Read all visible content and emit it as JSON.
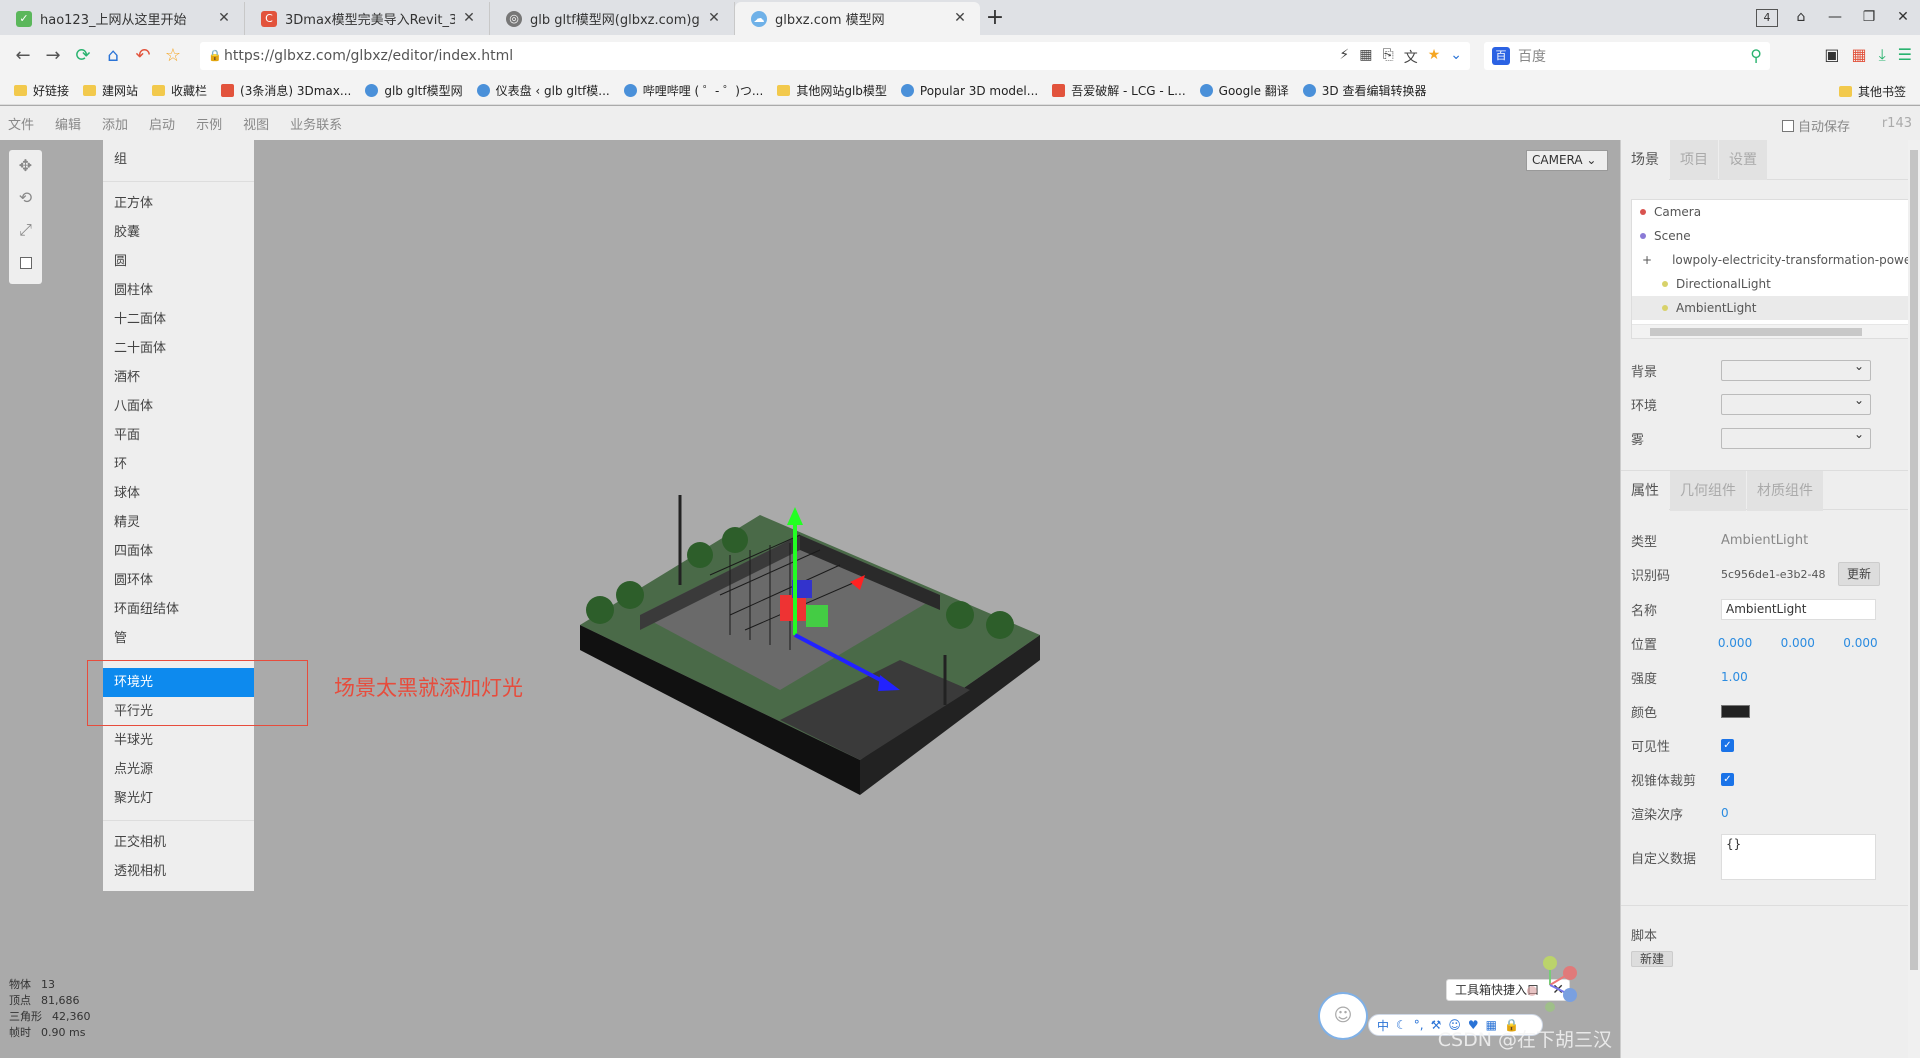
{
  "browser": {
    "tabs": [
      {
        "title": "hao123_上网从这里开始",
        "active": false
      },
      {
        "title": "3Dmax模型完美导入Revit_3dmax",
        "active": false
      },
      {
        "title": "glb gltf模型网(glbxz.com)glb模",
        "active": false
      },
      {
        "title": "glbxz.com 模型网",
        "active": true
      }
    ],
    "tab_count": "4",
    "url": "https://glbxz.com/glbxz/editor/index.html",
    "search_placeholder": "百度",
    "bookmarks": [
      "好链接",
      "建网站",
      "收藏栏",
      "(3条消息) 3Dmax...",
      "glb gltf模型网",
      "仪表盘 ‹ glb gltf模...",
      "哔哩哔哩 ( ゜- ゜)つ...",
      "其他网站glb模型",
      "Popular 3D model...",
      "吾爱破解 - LCG - L...",
      "Google 翻译",
      "3D 查看编辑转换器"
    ],
    "other_bookmarks": "其他书签"
  },
  "editor": {
    "menu": [
      "文件",
      "编辑",
      "添加",
      "启动",
      "示例",
      "视图",
      "业务联系"
    ],
    "autosave_label": "自动保存",
    "version": "r143",
    "camera_label": "CAMERA",
    "add_menu": {
      "group": "组",
      "meshes": [
        "正方体",
        "胶囊",
        "圆",
        "圆柱体",
        "十二面体",
        "二十面体",
        "酒杯",
        "八面体",
        "平面",
        "环",
        "球体",
        "精灵",
        "四面体",
        "圆环体",
        "环面纽结体",
        "管"
      ],
      "lights": [
        "环境光",
        "平行光",
        "半球光",
        "点光源",
        "聚光灯"
      ],
      "selected_light": "环境光",
      "cameras": [
        "正交相机",
        "透视相机"
      ]
    },
    "annotation": "场景太黑就添加灯光",
    "stats": [
      {
        "label": "物体",
        "value": "13"
      },
      {
        "label": "顶点",
        "value": "81,686"
      },
      {
        "label": "三角形",
        "value": "42,360"
      },
      {
        "label": "帧时",
        "value": "0.90 ms"
      }
    ],
    "toolbox_tip": "工具箱快捷入口",
    "ime_first": "中",
    "watermark": "CSDN @在下胡三汉"
  },
  "sidebar": {
    "tabs": [
      "场景",
      "项目",
      "设置"
    ],
    "outliner": [
      {
        "name": "Camera",
        "dot": "#d9534f",
        "indent": 0
      },
      {
        "name": "Scene",
        "dot": "#8a7ad6",
        "indent": 0
      },
      {
        "name": "lowpoly-electricity-transformation-power-plant",
        "dot": "#8a7ad6",
        "indent": 1,
        "expander": "+"
      },
      {
        "name": "DirectionalLight",
        "dot": "#d8d26a",
        "indent": 1
      },
      {
        "name": "AmbientLight",
        "dot": "#d8d26a",
        "indent": 1
      }
    ],
    "scene_props": [
      {
        "label": "背景"
      },
      {
        "label": "环境"
      },
      {
        "label": "雾"
      }
    ],
    "prop_tabs": [
      "属性",
      "几何组件",
      "材质组件"
    ],
    "object": {
      "type_label": "类型",
      "type_value": "AmbientLight",
      "uuid_label": "识别码",
      "uuid_value": "5c956de1-e3b2-48",
      "update_button": "更新",
      "name_label": "名称",
      "name_value": "AmbientLight",
      "position_label": "位置",
      "position": [
        "0.000",
        "0.000",
        "0.000"
      ],
      "intensity_label": "强度",
      "intensity": "1.00",
      "color_label": "颜色",
      "color": "#222222",
      "visible_label": "可见性",
      "frustum_label": "视锥体裁剪",
      "render_order_label": "渲染次序",
      "render_order": "0",
      "userdata_label": "自定义数据",
      "userdata": "{}"
    },
    "script_label": "脚本",
    "new_button": "新建"
  }
}
